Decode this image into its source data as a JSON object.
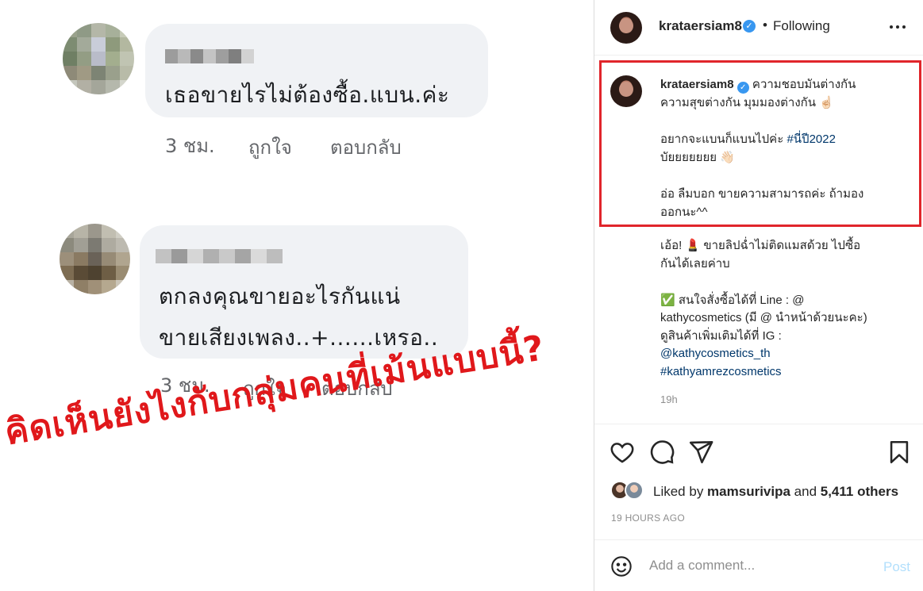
{
  "left": {
    "comments": [
      {
        "text": "เธอขายไรไม่ต้องซื้อ.แบน.ค่ะ",
        "time": "3 ชม.",
        "like": "ถูกใจ",
        "reply": "ตอบกลับ"
      },
      {
        "text_line1": "ตกลงคุณขายอะไรกันแน่",
        "text_line2": "ขายเสียงเพลง..+......เหรอ..",
        "time": "3 ชม.",
        "like": "ถูกใจ",
        "reply": "ตอบกลับ"
      }
    ],
    "headline": "คิดเห็นยังไงกับกลุ่มคนที่เม้นแบบนี้?",
    "headline_color": "#e0181b"
  },
  "instagram": {
    "header": {
      "username": "krataersiam8",
      "separator": "•",
      "following": "Following",
      "more_icon": "more-horizontal-icon"
    },
    "caption": {
      "username": "krataersiam8",
      "line1": "ความชอบมันต่างกัน",
      "line2": "ความสุขต่างกัน มุมมองต่างกัน ☝🏻",
      "line3_prefix": "อยากจะแบนก็แบนไปค่ะ ",
      "hashtag": "#นี่ปี2022",
      "line4": "บัยยยยยยย 👋🏻",
      "line5": "อ่อ ลืมบอก ขายความสามารถค่ะ ถ้ามอง",
      "line6": "ออกนะ^^"
    },
    "caption_highlight_color": "#e0252b",
    "post_text": {
      "line1": "เอ้อ! 💄 ขายลิปฉ่ำไม่ติดแมสด้วย ไปซื้อ",
      "line2": "กันได้เลยค่าบ",
      "line3": "✅ สนใจสั่งซื้อได้ที่ Line : @",
      "line4": "kathycosmetics (มี @ นำหน้าด้วยนะคะ)",
      "line5": "ดูสินค้าเพิ่มเติมได้ที่ IG :",
      "mention": "@kathycosmetics_th",
      "hashtag2": "#kathyamrezcosmetics"
    },
    "age": "19h",
    "likes": {
      "prefix": "Liked by ",
      "user": "mamsurivipa",
      "middle": " and ",
      "count": "5,411 others"
    },
    "posted": "19 HOURS AGO",
    "comment_box": {
      "placeholder": "Add a comment...",
      "post": "Post",
      "emoji_icon": "smiley-icon"
    },
    "action_icons": [
      "heart-icon",
      "comment-icon",
      "share-icon",
      "bookmark-icon"
    ]
  }
}
